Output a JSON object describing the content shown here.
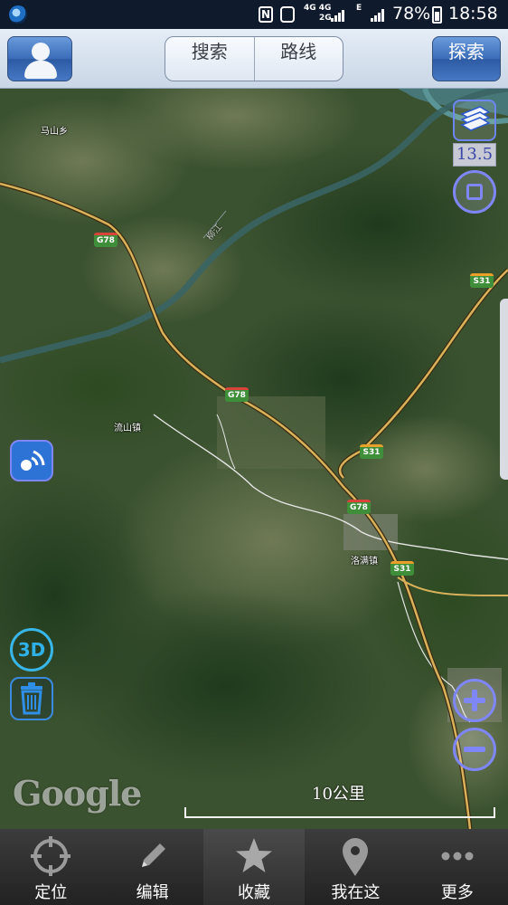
{
  "status_bar": {
    "nfc": "N",
    "network_top": "4G 4G",
    "network_bottom": "2G",
    "network_e": "E",
    "battery": "78%",
    "time": "18:58"
  },
  "top_bar": {
    "search_label": "搜索",
    "route_label": "路线",
    "explore_label": "探索"
  },
  "map": {
    "zoom_level": "13.5",
    "places": {
      "mashan": "马山乡",
      "liushan": "流山镇",
      "luoman": "洛满镇",
      "river": "柳江"
    },
    "road_shields": {
      "g78_a": "G78",
      "g78_b": "G78",
      "g78_c": "G78",
      "s31_a": "S31",
      "s31_b": "S31",
      "s31_c": "S31"
    },
    "three_d_label": "3D",
    "watermark": "Google",
    "scale_label": "10公里"
  },
  "bottom_nav": {
    "items": [
      {
        "label": "定位",
        "icon": "crosshair-icon"
      },
      {
        "label": "编辑",
        "icon": "pencil-icon"
      },
      {
        "label": "收藏",
        "icon": "star-icon"
      },
      {
        "label": "我在这",
        "icon": "map-pin-icon"
      },
      {
        "label": "更多",
        "icon": "more-dots-icon"
      }
    ]
  },
  "colors": {
    "accent": "#7f86f7",
    "highway_shield": "#3f8e3a",
    "road": "#d9b15b"
  }
}
